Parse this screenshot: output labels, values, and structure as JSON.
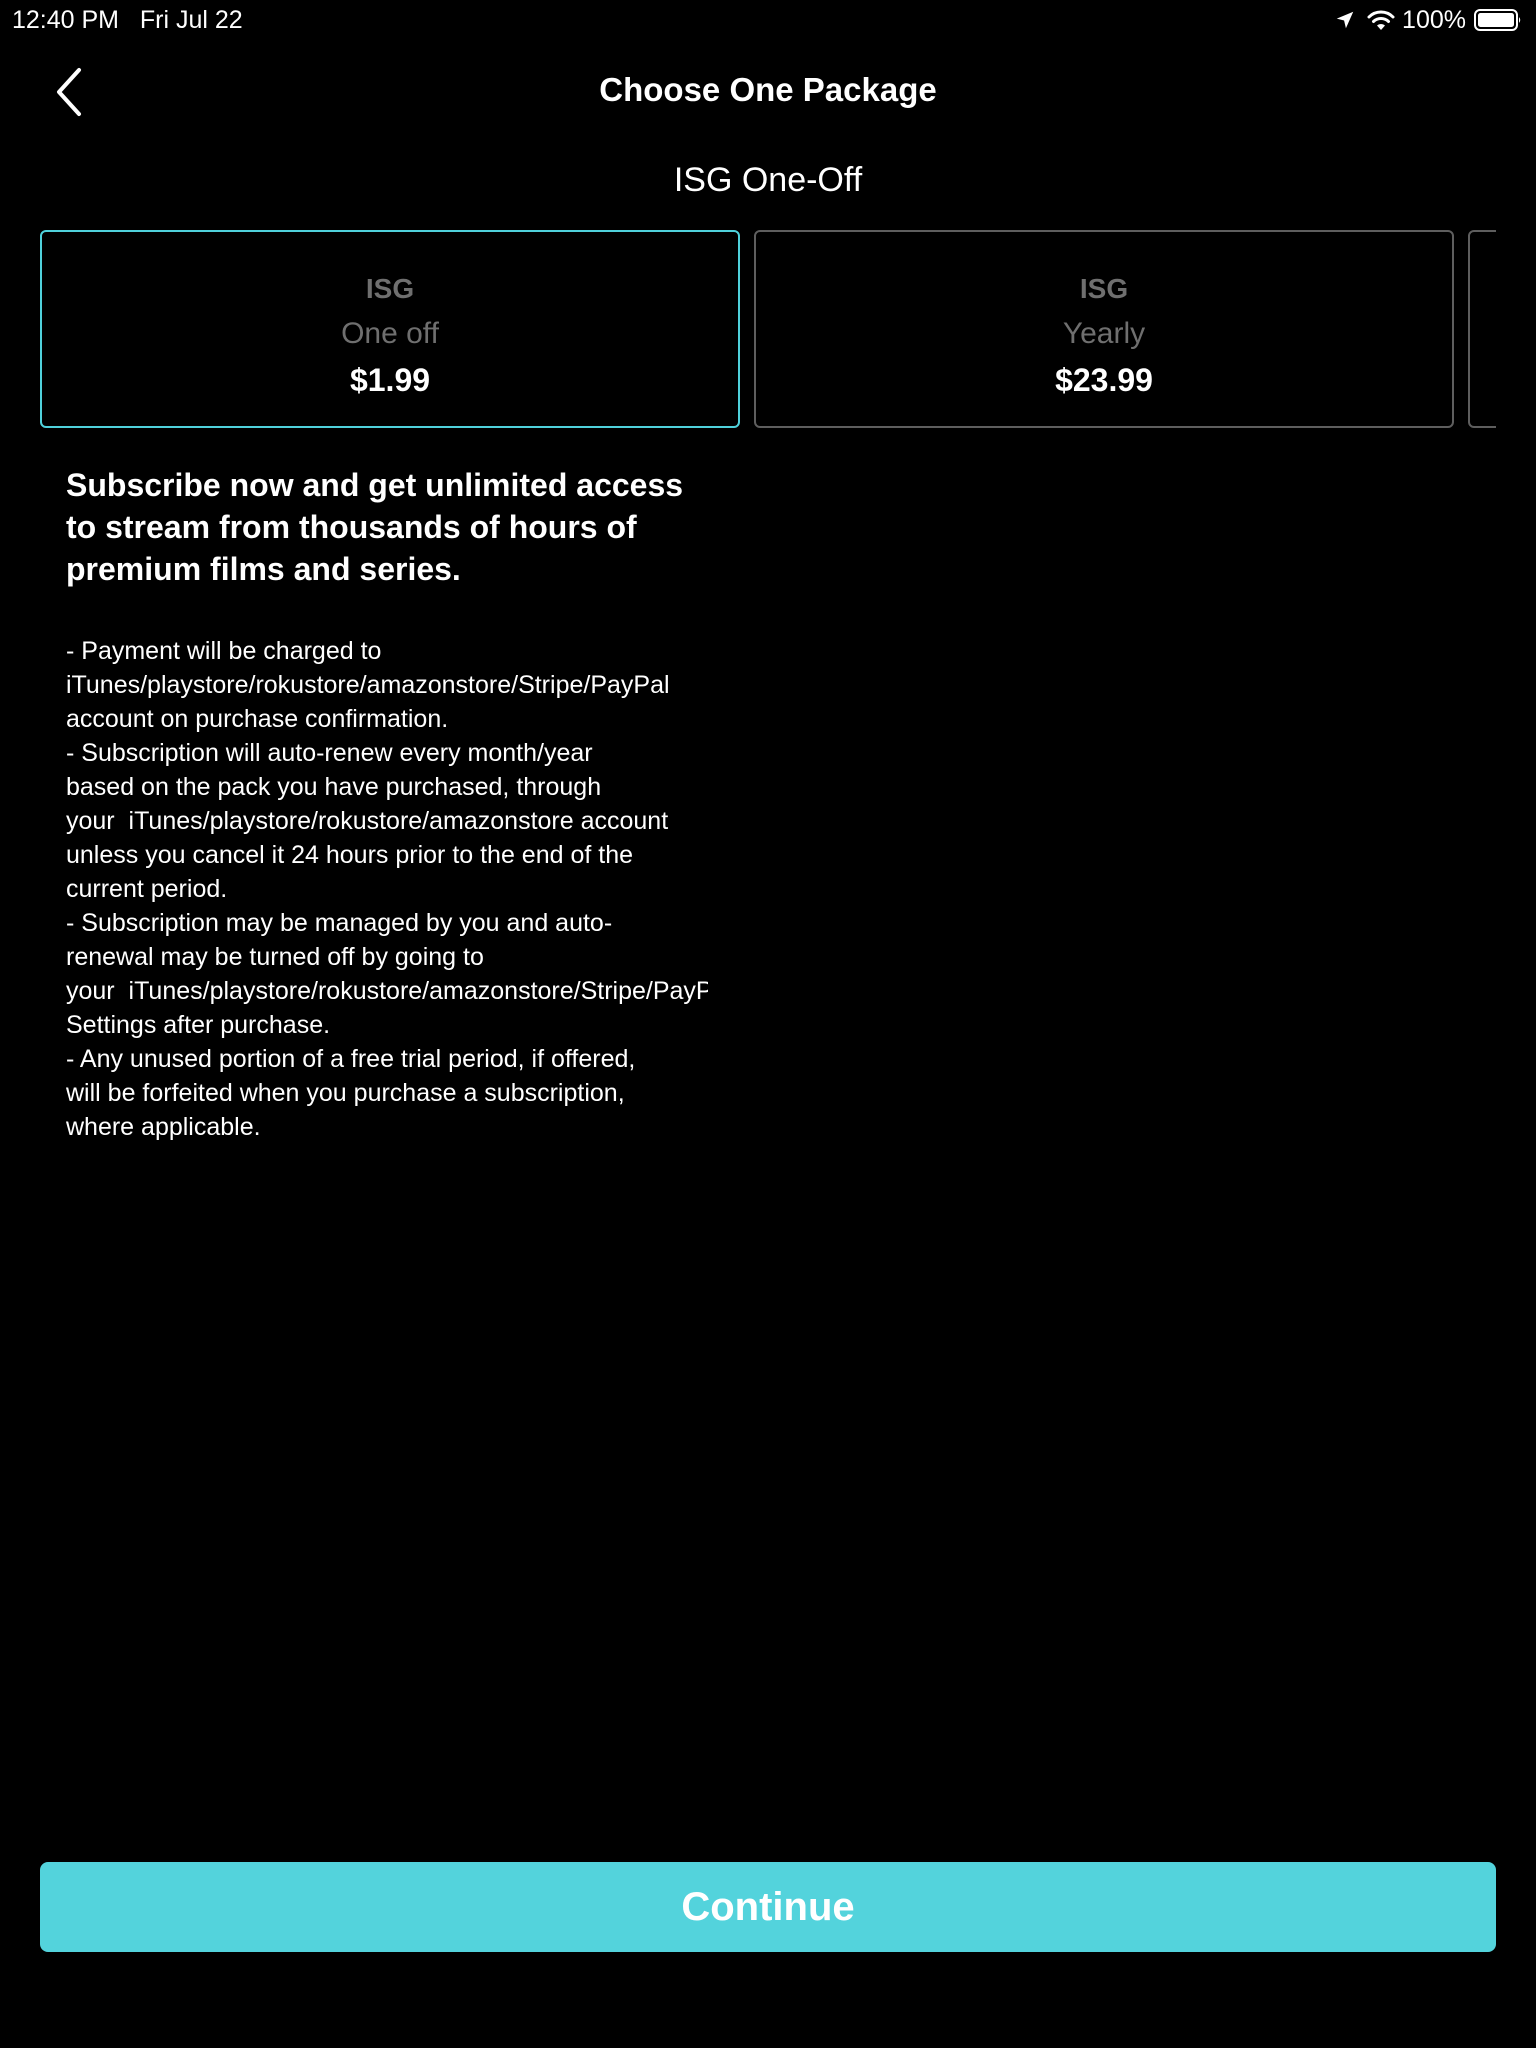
{
  "status_bar": {
    "time_date": "12:40 PM   Fri Jul 22",
    "battery": "100%"
  },
  "nav": {
    "title": "Choose One Package"
  },
  "package_subtitle": "ISG One-Off",
  "packages": [
    {
      "name": "ISG",
      "period": "One off",
      "price": "$1.99",
      "selected": true
    },
    {
      "name": "ISG",
      "period": "Yearly",
      "price": "$23.99",
      "selected": false
    },
    {
      "name": "",
      "period": "",
      "price": "",
      "selected": false
    }
  ],
  "description": {
    "headline": "Subscribe now and get unlimited access to stream from thousands of hours of premium films and series.",
    "terms": "- Payment will be charged to\niTunes/playstore/rokustore/amazonstore/Stripe/PayPal\naccount on purchase confirmation.\n- Subscription will auto-renew every month/year\nbased on the pack you have purchased, through\nyour  iTunes/playstore/rokustore/amazonstore account\nunless you cancel it 24 hours prior to the end of the\ncurrent period.\n- Subscription may be managed by you and auto-\nrenewal may be turned off by going to\nyour  iTunes/playstore/rokustore/amazonstore/Stripe/PayPal\nSettings after purchase.\n- Any unused portion of a free trial period, if offered,\nwill be forfeited when you purchase a subscription,\nwhere applicable."
  },
  "continue_label": "Continue",
  "colors": {
    "accent": "#53d3dc",
    "selected_border": "#4fd1db",
    "background": "#000000"
  },
  "icons": [
    "location-arrow-icon",
    "wifi-icon",
    "battery-icon",
    "back-chevron-icon"
  ]
}
